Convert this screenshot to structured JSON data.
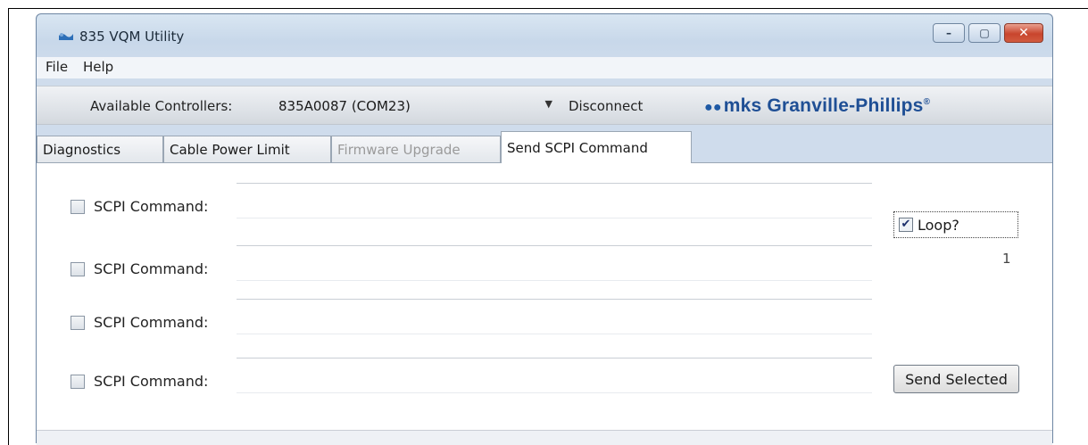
{
  "window": {
    "title": "835 VQM Utility",
    "controls": {
      "minimize": "–",
      "maximize": "▢",
      "close": "✕"
    }
  },
  "menu": {
    "items": [
      "File",
      "Help"
    ]
  },
  "controller_bar": {
    "label": "Available Controllers:",
    "selected_controller": "835A0087 (COM23)",
    "disconnect_label": "Disconnect",
    "brand": "mks Granville-Phillips",
    "brand_mark": "®"
  },
  "tabs": [
    {
      "label": "Diagnostics",
      "state": "normal"
    },
    {
      "label": "Cable Power Limit",
      "state": "normal"
    },
    {
      "label": "Firmware Upgrade",
      "state": "disabled"
    },
    {
      "label": "Send SCPI Command",
      "state": "active"
    }
  ],
  "scpi_rows": [
    {
      "label": "SCPI Command:",
      "checked": false,
      "value": ""
    },
    {
      "label": "SCPI Command:",
      "checked": false,
      "value": ""
    },
    {
      "label": "SCPI Command:",
      "checked": false,
      "value": ""
    },
    {
      "label": "SCPI Command:",
      "checked": false,
      "value": ""
    }
  ],
  "loop": {
    "label": "Loop?",
    "checked": true,
    "check_glyph": "✔",
    "count": "1"
  },
  "send_button": "Send Selected",
  "colors": {
    "brand_blue": "#1f4f95",
    "close_red": "#c8452d"
  }
}
